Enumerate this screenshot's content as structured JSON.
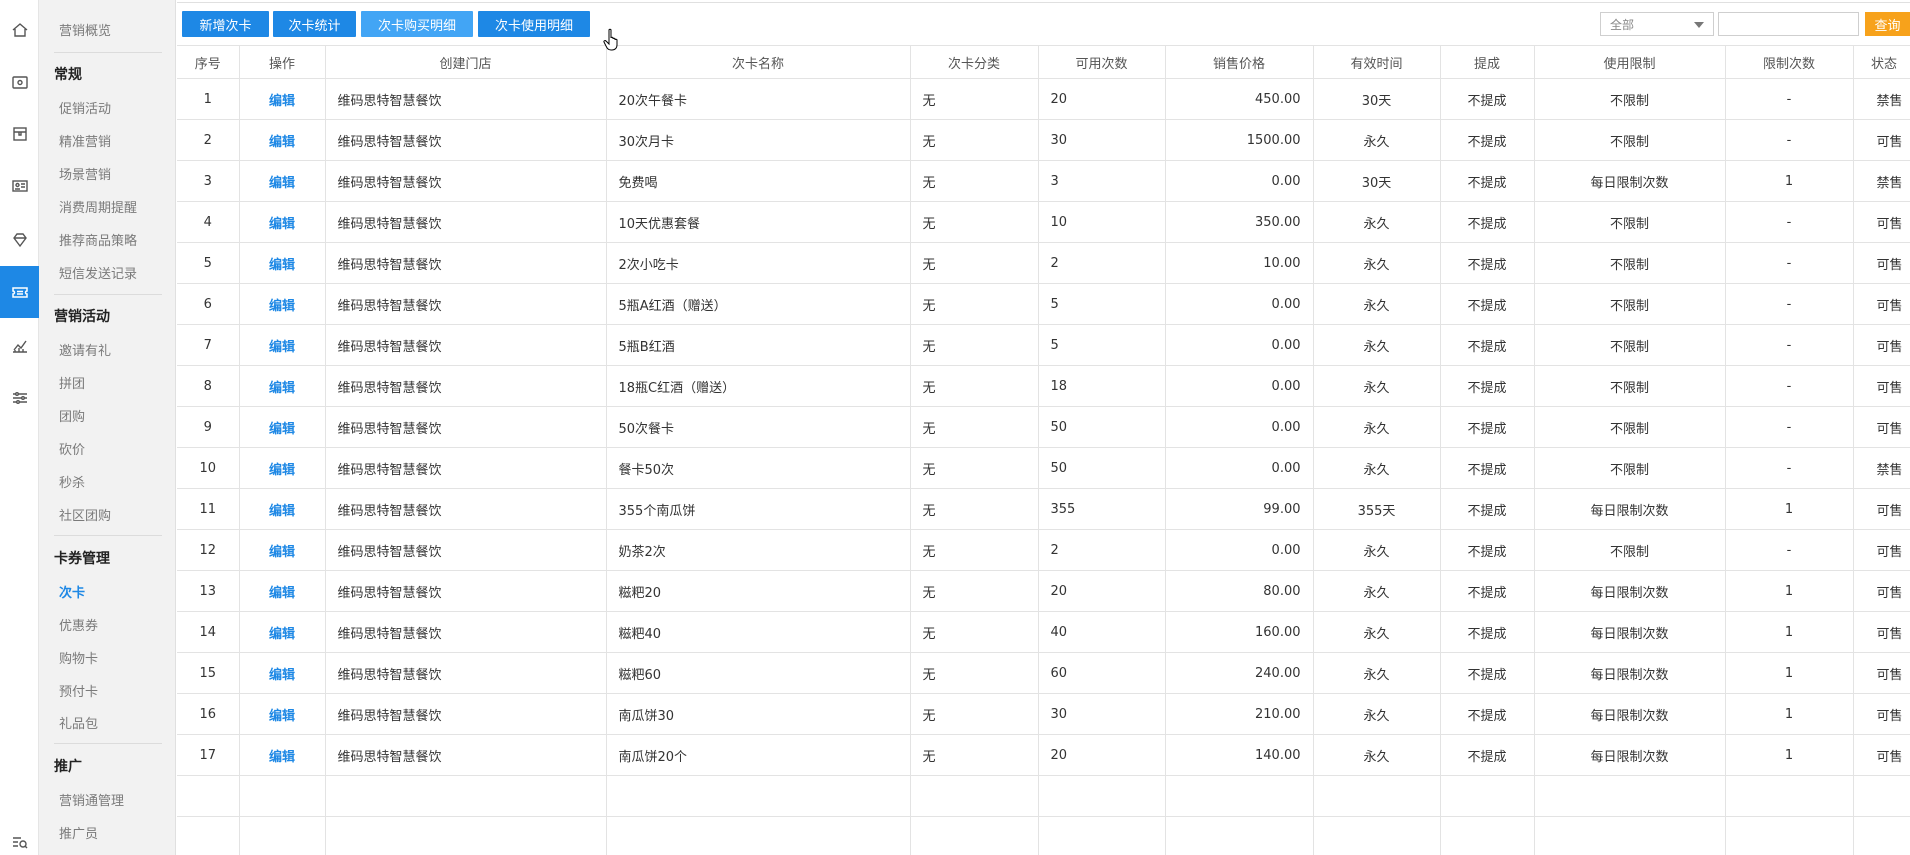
{
  "sidebar": {
    "sections": [
      {
        "heading": "",
        "links": [
          {
            "label": "营销概览"
          }
        ]
      },
      {
        "heading": "常规",
        "links": [
          {
            "label": "促销活动"
          },
          {
            "label": "精准营销"
          },
          {
            "label": "场景营销"
          },
          {
            "label": "消费周期提醒"
          },
          {
            "label": "推荐商品策略"
          },
          {
            "label": "短信发送记录"
          }
        ]
      },
      {
        "heading": "营销活动",
        "links": [
          {
            "label": "邀请有礼"
          },
          {
            "label": "拼团"
          },
          {
            "label": "团购"
          },
          {
            "label": "砍价"
          },
          {
            "label": "秒杀"
          },
          {
            "label": "社区团购"
          }
        ]
      },
      {
        "heading": "卡券管理",
        "links": [
          {
            "label": "次卡",
            "active": true
          },
          {
            "label": "优惠券"
          },
          {
            "label": "购物卡"
          },
          {
            "label": "预付卡"
          },
          {
            "label": "礼品包"
          }
        ]
      },
      {
        "heading": "推广",
        "links": [
          {
            "label": "营销通管理"
          },
          {
            "label": "推广员"
          }
        ]
      }
    ]
  },
  "rail": {
    "icons": [
      "home-icon",
      "wallet-icon",
      "store-icon",
      "id-card-icon",
      "diamond-icon",
      "ticket-icon",
      "chart-icon",
      "sliders-icon",
      "search-list-icon"
    ],
    "active_index": 5,
    "accent": "#1e88e5"
  },
  "toolbar": {
    "buttons": [
      "新增次卡",
      "次卡统计",
      "次卡购买明细",
      "次卡使用明细"
    ],
    "filter_value": "全部",
    "search_value": "",
    "query_label": "查询",
    "query_color": "#f7a21b"
  },
  "table": {
    "columns": [
      "序号",
      "操作",
      "创建门店",
      "次卡名称",
      "次卡分类",
      "可用次数",
      "销售价格",
      "有效时间",
      "提成",
      "使用限制",
      "限制次数",
      "状态"
    ],
    "rows": [
      [
        "1",
        "编辑",
        "维码思特智慧餐饮",
        "20次午餐卡",
        "无",
        "20",
        "450.00",
        "30天",
        "不提成",
        "不限制",
        "-",
        "禁售"
      ],
      [
        "2",
        "编辑",
        "维码思特智慧餐饮",
        "30次月卡",
        "无",
        "30",
        "1500.00",
        "永久",
        "不提成",
        "不限制",
        "-",
        "可售"
      ],
      [
        "3",
        "编辑",
        "维码思特智慧餐饮",
        "免费喝",
        "无",
        "3",
        "0.00",
        "30天",
        "不提成",
        "每日限制次数",
        "1",
        "禁售"
      ],
      [
        "4",
        "编辑",
        "维码思特智慧餐饮",
        "10天优惠套餐",
        "无",
        "10",
        "350.00",
        "永久",
        "不提成",
        "不限制",
        "-",
        "可售"
      ],
      [
        "5",
        "编辑",
        "维码思特智慧餐饮",
        "2次小吃卡",
        "无",
        "2",
        "10.00",
        "永久",
        "不提成",
        "不限制",
        "-",
        "可售"
      ],
      [
        "6",
        "编辑",
        "维码思特智慧餐饮",
        "5瓶A红酒（赠送）",
        "无",
        "5",
        "0.00",
        "永久",
        "不提成",
        "不限制",
        "-",
        "可售"
      ],
      [
        "7",
        "编辑",
        "维码思特智慧餐饮",
        "5瓶B红酒",
        "无",
        "5",
        "0.00",
        "永久",
        "不提成",
        "不限制",
        "-",
        "可售"
      ],
      [
        "8",
        "编辑",
        "维码思特智慧餐饮",
        "18瓶C红酒（赠送）",
        "无",
        "18",
        "0.00",
        "永久",
        "不提成",
        "不限制",
        "-",
        "可售"
      ],
      [
        "9",
        "编辑",
        "维码思特智慧餐饮",
        "50次餐卡",
        "无",
        "50",
        "0.00",
        "永久",
        "不提成",
        "不限制",
        "-",
        "可售"
      ],
      [
        "10",
        "编辑",
        "维码思特智慧餐饮",
        "餐卡50次",
        "无",
        "50",
        "0.00",
        "永久",
        "不提成",
        "不限制",
        "-",
        "禁售"
      ],
      [
        "11",
        "编辑",
        "维码思特智慧餐饮",
        "355个南瓜饼",
        "无",
        "355",
        "99.00",
        "355天",
        "不提成",
        "每日限制次数",
        "1",
        "可售"
      ],
      [
        "12",
        "编辑",
        "维码思特智慧餐饮",
        "奶茶2次",
        "无",
        "2",
        "0.00",
        "永久",
        "不提成",
        "不限制",
        "-",
        "可售"
      ],
      [
        "13",
        "编辑",
        "维码思特智慧餐饮",
        "糍粑20",
        "无",
        "20",
        "80.00",
        "永久",
        "不提成",
        "每日限制次数",
        "1",
        "可售"
      ],
      [
        "14",
        "编辑",
        "维码思特智慧餐饮",
        "糍粑40",
        "无",
        "40",
        "160.00",
        "永久",
        "不提成",
        "每日限制次数",
        "1",
        "可售"
      ],
      [
        "15",
        "编辑",
        "维码思特智慧餐饮",
        "糍粑60",
        "无",
        "60",
        "240.00",
        "永久",
        "不提成",
        "每日限制次数",
        "1",
        "可售"
      ],
      [
        "16",
        "编辑",
        "维码思特智慧餐饮",
        "南瓜饼30",
        "无",
        "30",
        "210.00",
        "永久",
        "不提成",
        "每日限制次数",
        "1",
        "可售"
      ],
      [
        "17",
        "编辑",
        "维码思特智慧餐饮",
        "南瓜饼20个",
        "无",
        "20",
        "140.00",
        "永久",
        "不提成",
        "每日限制次数",
        "1",
        "可售"
      ]
    ]
  }
}
